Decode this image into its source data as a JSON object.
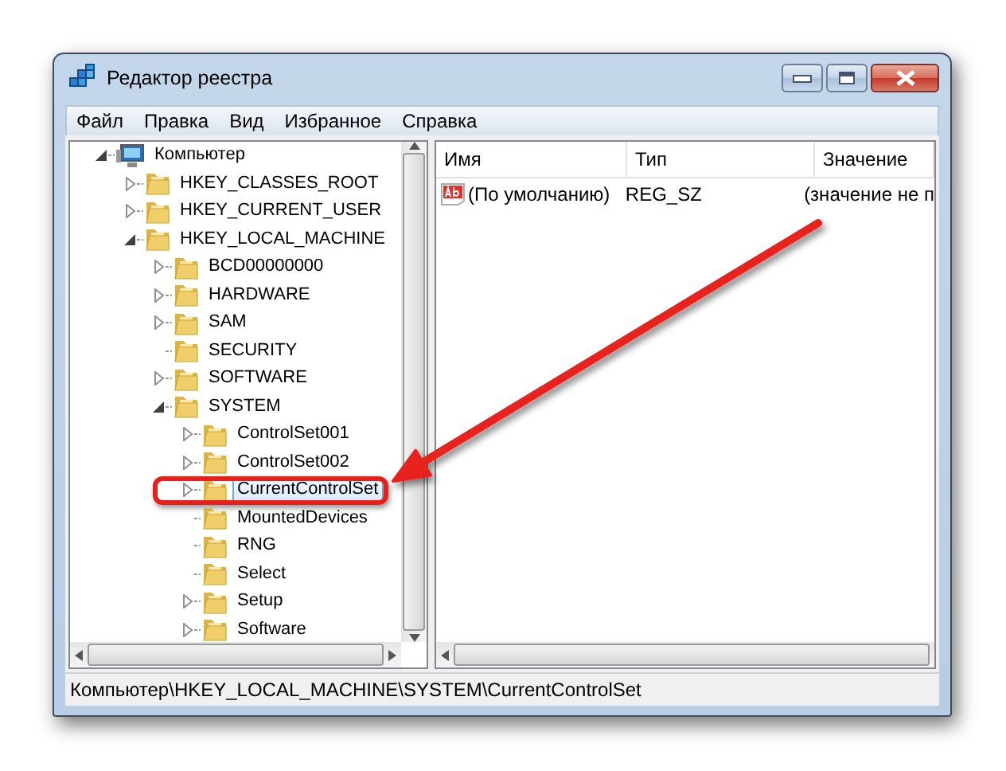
{
  "window": {
    "title": "Редактор реестра"
  },
  "menu": [
    "Файл",
    "Правка",
    "Вид",
    "Избранное",
    "Справка"
  ],
  "tree": [
    {
      "label": "Компьютер",
      "kind": "computer",
      "expandable": true,
      "expanded": true,
      "selected": false,
      "children": [
        {
          "label": "HKEY_CLASSES_ROOT",
          "kind": "folder",
          "expandable": true,
          "expanded": false,
          "selected": false
        },
        {
          "label": "HKEY_CURRENT_USER",
          "kind": "folder",
          "expandable": true,
          "expanded": false,
          "selected": false
        },
        {
          "label": "HKEY_LOCAL_MACHINE",
          "kind": "folder",
          "expandable": true,
          "expanded": true,
          "selected": false,
          "children": [
            {
              "label": "BCD00000000",
              "kind": "folder",
              "expandable": true,
              "expanded": false,
              "selected": false
            },
            {
              "label": "HARDWARE",
              "kind": "folder",
              "expandable": true,
              "expanded": false,
              "selected": false
            },
            {
              "label": "SAM",
              "kind": "folder",
              "expandable": true,
              "expanded": false,
              "selected": false
            },
            {
              "label": "SECURITY",
              "kind": "folder",
              "expandable": false,
              "selected": false
            },
            {
              "label": "SOFTWARE",
              "kind": "folder",
              "expandable": true,
              "expanded": false,
              "selected": false
            },
            {
              "label": "SYSTEM",
              "kind": "folder",
              "expandable": true,
              "expanded": true,
              "selected": false,
              "children": [
                {
                  "label": "ControlSet001",
                  "kind": "folder",
                  "expandable": true,
                  "expanded": false,
                  "selected": false
                },
                {
                  "label": "ControlSet002",
                  "kind": "folder",
                  "expandable": true,
                  "expanded": false,
                  "selected": false
                },
                {
                  "label": "CurrentControlSet",
                  "kind": "folder",
                  "expandable": true,
                  "expanded": false,
                  "selected": true
                },
                {
                  "label": "MountedDevices",
                  "kind": "folder",
                  "expandable": false,
                  "selected": false
                },
                {
                  "label": "RNG",
                  "kind": "folder",
                  "expandable": false,
                  "selected": false
                },
                {
                  "label": "Select",
                  "kind": "folder",
                  "expandable": false,
                  "selected": false
                },
                {
                  "label": "Setup",
                  "kind": "folder",
                  "expandable": true,
                  "expanded": false,
                  "selected": false
                },
                {
                  "label": "Software",
                  "kind": "folder",
                  "expandable": true,
                  "expanded": false,
                  "selected": false
                }
              ]
            }
          ]
        }
      ]
    }
  ],
  "table": {
    "columns": [
      "Имя",
      "Тип",
      "Значение"
    ],
    "rows": [
      [
        "(По умолчанию)",
        "REG_SZ",
        "(значение не п"
      ]
    ]
  },
  "status_bar": "Компьютер\\HKEY_LOCAL_MACHINE\\SYSTEM\\CurrentControlSet"
}
